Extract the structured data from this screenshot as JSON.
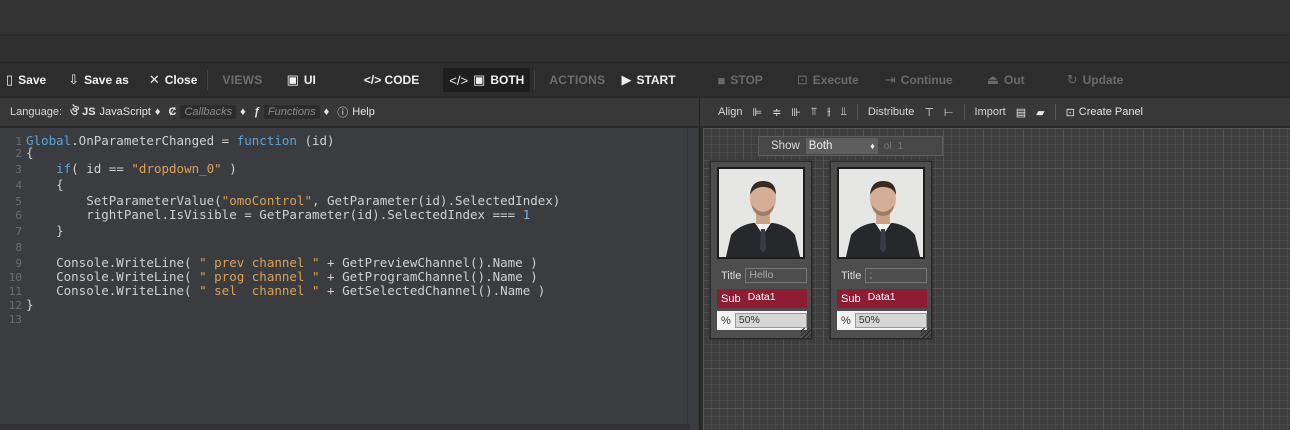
{
  "toolbar": {
    "save": "Save",
    "save_as": "Save as",
    "close": "Close",
    "views": "VIEWS",
    "ui": "UI",
    "code": "</> CODE",
    "both": "BOTH",
    "actions": "ACTIONS",
    "start": "START",
    "stop": "STOP",
    "execute": "Execute",
    "continue": "Continue",
    "out": "Out",
    "update": "Update"
  },
  "subbar": {
    "language_label": "Language:",
    "language_value": "JavaScript",
    "callbacks": "Callbacks",
    "functions": "Functions",
    "help": "Help",
    "align": "Align",
    "distribute": "Distribute",
    "import": "Import",
    "create_panel": "Create Panel"
  },
  "editor": {
    "line_numbers": [
      "1",
      "2",
      "3",
      "4",
      "5",
      "6",
      "7",
      "8",
      "9",
      "10",
      "11",
      "12",
      "13"
    ]
  },
  "canvas": {
    "show_label": "Show",
    "show_value": "Both",
    "show_dim_a": "ol",
    "show_dim_b": "1",
    "panels": [
      {
        "title_label": "Title",
        "title_value": "Hello",
        "sub_label": "Sub",
        "sub_value": "Data1",
        "pct_label": "%",
        "pct_value": "50%"
      },
      {
        "title_label": "Title",
        "title_value": ";",
        "sub_label": "Sub",
        "sub_value": "Data1",
        "pct_label": "%",
        "pct_value": "50%"
      }
    ]
  },
  "colors": {
    "sub_field": "#8e1c33",
    "keyword": "#5ba4d6",
    "string": "#d8a25c"
  }
}
